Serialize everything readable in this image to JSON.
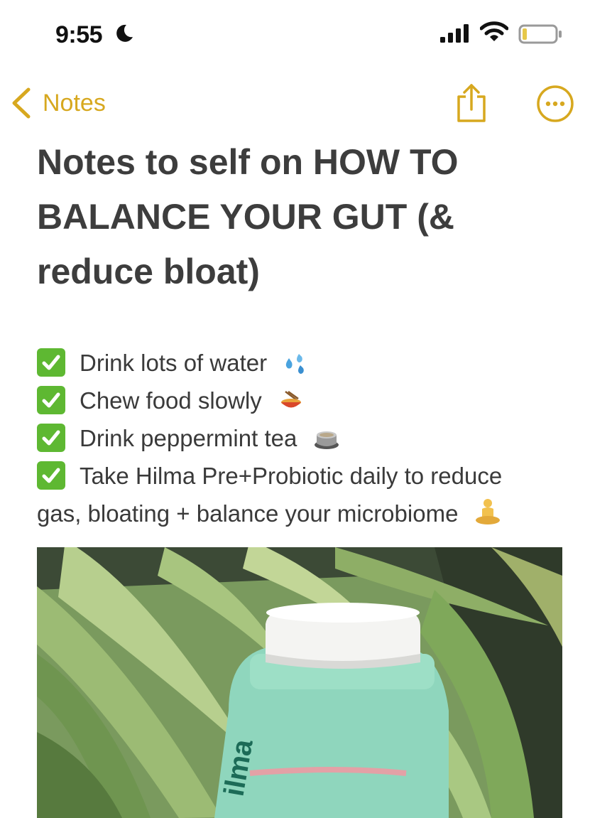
{
  "status_bar": {
    "time": "9:55"
  },
  "nav": {
    "back_label": "Notes"
  },
  "note": {
    "title": "Notes to self on HOW TO BALANCE YOUR GUT (& reduce bloat)",
    "checklist": [
      {
        "text": "Drink lots of water",
        "emoji": "water-drops-icon"
      },
      {
        "text": "Chew food slowly",
        "emoji": "food-bowl-icon"
      },
      {
        "text": "Drink peppermint tea",
        "emoji": "tea-cup-icon"
      },
      {
        "text": "Take Hilma Pre+Probiotic daily to reduce",
        "emoji": ""
      },
      {
        "text": "gas, bloating + balance your microbiome",
        "emoji": "meditation-icon"
      }
    ]
  },
  "colors": {
    "accent": "#d7a81f",
    "check": "#5eb832",
    "title": "#3d3d3d",
    "bottle": "#8fd6bd"
  },
  "photo": {
    "label_text": "ilma"
  }
}
